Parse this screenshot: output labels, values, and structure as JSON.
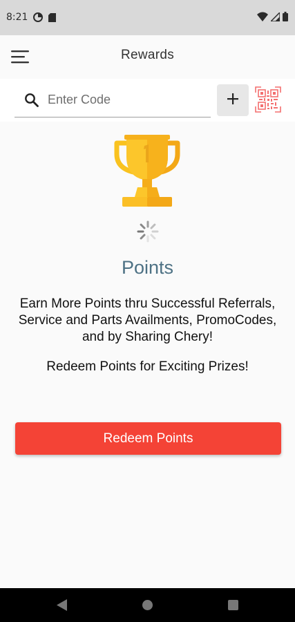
{
  "status_bar": {
    "time": "8:21",
    "left_icons": [
      "data-saver-icon",
      "sd-card-icon"
    ],
    "right_icons": [
      "wifi-icon",
      "signal-icon",
      "battery-icon"
    ]
  },
  "app_bar": {
    "title": "Rewards",
    "menu_icon": "menu-icon"
  },
  "search": {
    "placeholder": "Enter Code",
    "value": "",
    "add_icon": "plus-icon",
    "qr_icon": "qr-code-icon"
  },
  "rewards": {
    "trophy_icon": "trophy-icon",
    "loading_icon": "spinner-icon",
    "title": "Points",
    "description": "Earn More Points thru Successful Referrals, Service and Parts Availments, PromoCodes, and by Sharing Chery!",
    "redeem_text": "Redeem Points for Exciting Prizes!",
    "button_label": "Redeem Points"
  },
  "nav_bar": {
    "icons": [
      "back-icon",
      "home-icon",
      "recents-icon"
    ]
  },
  "colors": {
    "accent": "#f44336",
    "points_title": "#4d7184",
    "trophy": "#fbc02d",
    "status_bar": "#d9d9d9"
  }
}
